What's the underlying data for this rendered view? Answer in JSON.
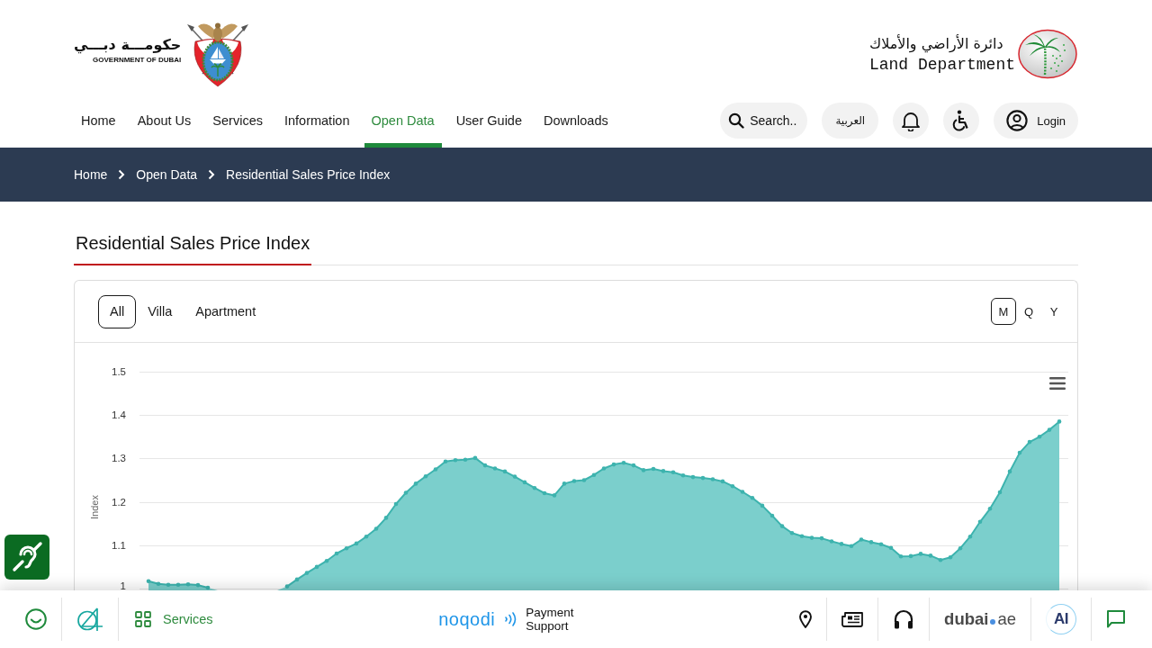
{
  "header": {
    "government_logo": {
      "arabic": "حكومـــة دبـــي",
      "english": "GOVERNMENT OF DUBAI"
    },
    "department_logo": {
      "arabic": "دائرة الأراضي والأملاك",
      "english": "Land Department"
    },
    "nav": [
      {
        "label": "Home",
        "selected": false
      },
      {
        "label": "About Us",
        "selected": false
      },
      {
        "label": "Services",
        "selected": false
      },
      {
        "label": "Information",
        "selected": false
      },
      {
        "label": "Open Data",
        "selected": true
      },
      {
        "label": "User Guide",
        "selected": false
      },
      {
        "label": "Downloads",
        "selected": false
      }
    ],
    "search_button": "Search..",
    "language_button": "العربية",
    "login_button": "Login"
  },
  "breadcrumb": [
    "Home",
    "Open Data",
    "Residential Sales Price Index"
  ],
  "page_title": "Residential Sales Price Index",
  "property_filters": [
    {
      "label": "All",
      "selected": true
    },
    {
      "label": "Villa",
      "selected": false
    },
    {
      "label": "Apartment",
      "selected": false
    }
  ],
  "period_filters": [
    {
      "label": "M",
      "selected": true
    },
    {
      "label": "Q",
      "selected": false
    },
    {
      "label": "Y",
      "selected": false
    }
  ],
  "chart_data": {
    "type": "area",
    "ylabel": "Index",
    "ylim": [
      1,
      1.5
    ],
    "yticks": [
      1,
      1.1,
      1.2,
      1.3,
      1.4,
      1.5
    ],
    "grid": true,
    "values": [
      1.017,
      1.011,
      1.009,
      1.009,
      1.01,
      1.008,
      1.002,
      null,
      null,
      null,
      null,
      null,
      null,
      null,
      1.005,
      1.021,
      1.036,
      1.05,
      1.064,
      1.081,
      1.093,
      1.104,
      1.12,
      1.138,
      1.163,
      1.195,
      1.221,
      1.242,
      1.259,
      1.275,
      1.293,
      1.296,
      1.297,
      1.301,
      1.284,
      1.277,
      1.27,
      1.258,
      1.245,
      1.232,
      1.22,
      1.215,
      1.242,
      1.248,
      1.25,
      1.262,
      1.277,
      1.286,
      1.29,
      1.284,
      1.273,
      1.276,
      1.271,
      1.268,
      1.261,
      1.257,
      1.255,
      1.252,
      1.247,
      1.236,
      1.223,
      1.209,
      1.191,
      1.168,
      1.144,
      1.128,
      1.121,
      1.117,
      1.116,
      1.109,
      1.103,
      1.098,
      1.113,
      1.107,
      1.102,
      1.094,
      1.074,
      1.075,
      1.08,
      1.076,
      1.066,
      1.072,
      1.093,
      1.12,
      1.154,
      1.184,
      1.222,
      1.27,
      1.313,
      1.338,
      1.35,
      1.366,
      1.385
    ]
  },
  "bottom_bar": {
    "services_button": "Services",
    "payment": {
      "brand": "noqodi",
      "label": "Payment Support"
    },
    "portal": {
      "name": "dubai",
      "domain": "ae"
    },
    "ai_button": "AI"
  }
}
